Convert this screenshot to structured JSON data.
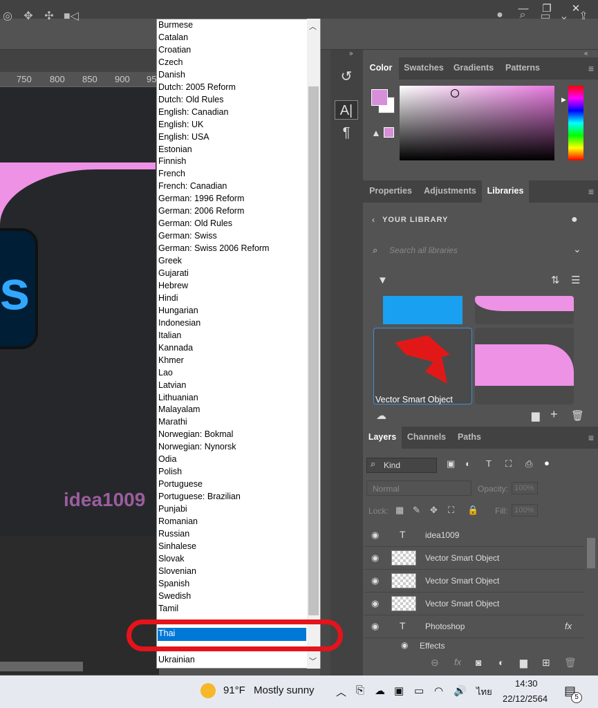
{
  "window": {
    "minimize": "—",
    "restore": "❐",
    "close": "✕"
  },
  "ruler": {
    "ticks": [
      "750",
      "800",
      "850",
      "900",
      "95"
    ]
  },
  "canvas": {
    "watermark": "idea1009"
  },
  "dropdown": {
    "languages": [
      "Burmese",
      "Catalan",
      "Croatian",
      "Czech",
      "Danish",
      "Dutch: 2005 Reform",
      "Dutch: Old Rules",
      "English: Canadian",
      "English: UK",
      "English: USA",
      "Estonian",
      "Finnish",
      "French",
      "French: Canadian",
      "German: 1996 Reform",
      "German: 2006 Reform",
      "German: Old Rules",
      "German: Swiss",
      "German: Swiss 2006 Reform",
      "Greek",
      "Gujarati",
      "Hebrew",
      "Hindi",
      "Hungarian",
      "Indonesian",
      "Italian",
      "Kannada",
      "Khmer",
      "Lao",
      "Latvian",
      "Lithuanian",
      "Malayalam",
      "Marathi",
      "Norwegian: Bokmal",
      "Norwegian: Nynorsk",
      "Odia",
      "Polish",
      "Portuguese",
      "Portuguese: Brazilian",
      "Punjabi",
      "Romanian",
      "Russian",
      "Sinhalese",
      "Slovak",
      "Slovenian",
      "Spanish",
      "Swedish",
      "Tamil"
    ],
    "selected": "Thai",
    "bottom": "Ukrainian"
  },
  "color_panel": {
    "tabs": [
      "Color",
      "Swatches",
      "Gradients",
      "Patterns"
    ],
    "fg_color": "#d68fd8"
  },
  "properties_panel": {
    "tabs": [
      "Properties",
      "Adjustments",
      "Libraries"
    ]
  },
  "libraries": {
    "header": "YOUR LIBRARY",
    "search_placeholder": "Search all libraries",
    "item_label": "Vector Smart Object"
  },
  "layers_panel": {
    "tabs": [
      "Layers",
      "Channels",
      "Paths"
    ],
    "filter": "Kind",
    "blend_mode": "Normal",
    "opacity_label": "Opacity:",
    "opacity_value": "100%",
    "lock_label": "Lock:",
    "fill_label": "Fill:",
    "fill_value": "100%",
    "layers": [
      {
        "name": "idea1009",
        "type": "text"
      },
      {
        "name": "Vector Smart Object",
        "type": "smart"
      },
      {
        "name": "Vector Smart Object",
        "type": "smart"
      },
      {
        "name": "Vector Smart Object",
        "type": "smart"
      },
      {
        "name": "Photoshop",
        "type": "text"
      }
    ],
    "effects_label": "Effects"
  },
  "taskbar": {
    "weather_temp": "91°F",
    "weather_text": "Mostly sunny",
    "lang": "ไทย",
    "time": "14:30",
    "date": "22/12/2564",
    "notif_count": "5"
  }
}
